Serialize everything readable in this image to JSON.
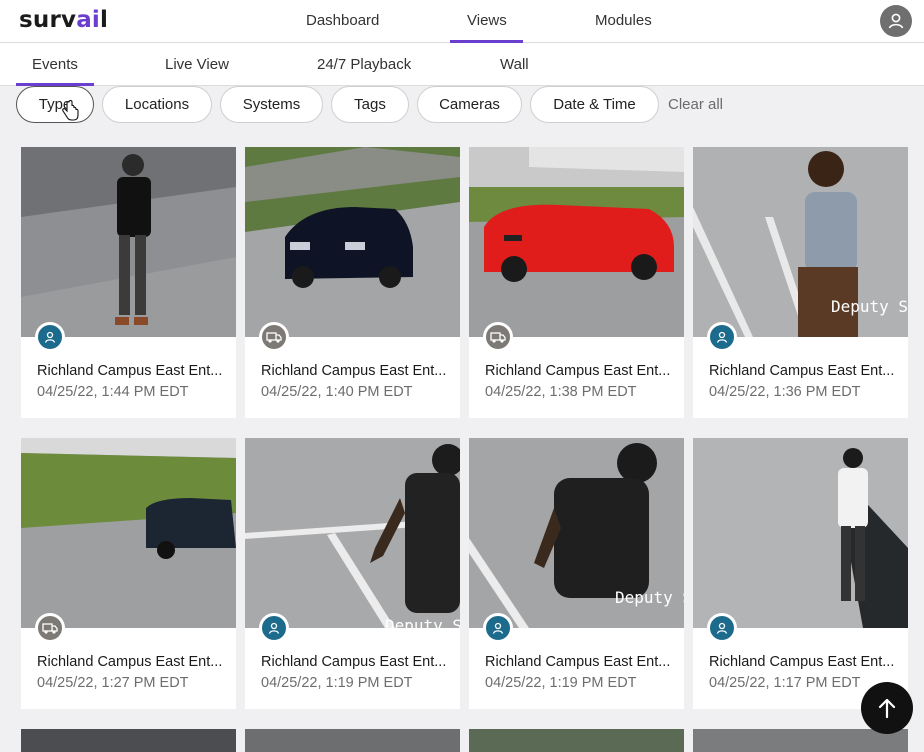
{
  "brand": {
    "logo_pre": "surv",
    "logo_accent": "ai",
    "logo_post": "l",
    "accent_color": "#6a3fd0"
  },
  "main_nav": [
    "Dashboard",
    "Views",
    "Modules"
  ],
  "main_nav_active": "Views",
  "sub_nav": [
    "Events",
    "Live View",
    "24/7 Playback",
    "Wall"
  ],
  "sub_nav_active": "Events",
  "filters": [
    "Type",
    "Locations",
    "Systems",
    "Tags",
    "Cameras",
    "Date & Time"
  ],
  "clear_all": "Clear all",
  "events": [
    {
      "title": "Richland Campus East Ent...",
      "time": "04/25/22, 1:44 PM EDT",
      "type": "person"
    },
    {
      "title": "Richland Campus East Ent...",
      "time": "04/25/22, 1:40 PM EDT",
      "type": "vehicle"
    },
    {
      "title": "Richland Campus East Ent...",
      "time": "04/25/22, 1:38 PM EDT",
      "type": "vehicle"
    },
    {
      "title": "Richland Campus East Ent...",
      "time": "04/25/22, 1:36 PM EDT",
      "type": "person"
    },
    {
      "title": "Richland Campus East Ent...",
      "time": "04/25/22, 1:27 PM EDT",
      "type": "vehicle"
    },
    {
      "title": "Richland Campus East Ent...",
      "time": "04/25/22, 1:19 PM EDT",
      "type": "person"
    },
    {
      "title": "Richland Campus East Ent...",
      "time": "04/25/22, 1:19 PM EDT",
      "type": "person"
    },
    {
      "title": "Richland Campus East Ent...",
      "time": "04/25/22, 1:17 PM EDT",
      "type": "person"
    }
  ],
  "overlays": {
    "deputy": "Deputy S"
  },
  "icons": {
    "avatar": "user-icon",
    "person": "person-icon",
    "vehicle": "truck-icon",
    "scroll": "arrow-up-icon",
    "cursor": "hand-pointer-icon"
  }
}
